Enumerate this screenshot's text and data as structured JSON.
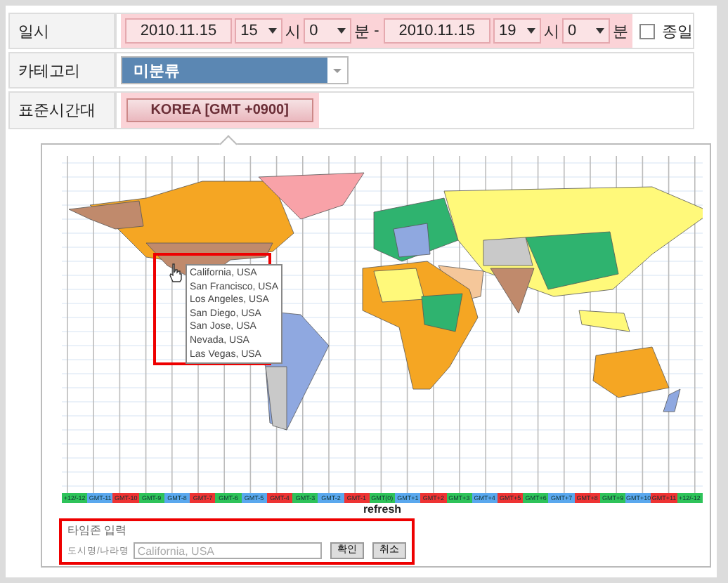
{
  "datetime": {
    "label": "일시",
    "start": {
      "date": "2010.11.15",
      "hour": "15",
      "hour_unit": "시",
      "minute": "0",
      "minute_unit": "분"
    },
    "separator": "-",
    "end": {
      "date": "2010.11.15",
      "hour": "19",
      "hour_unit": "시",
      "minute": "0",
      "minute_unit": "분"
    },
    "all_day": {
      "label": "종일",
      "checked": false
    }
  },
  "category": {
    "label": "카테고리",
    "value": "미분류"
  },
  "timezone": {
    "label": "표준시간대",
    "button": "KOREA [GMT +0900]"
  },
  "map": {
    "popup": {
      "items": [
        "California, USA",
        "San Francisco, USA",
        "Los Angeles, USA",
        "San Diego, USA",
        "San Jose, USA",
        "Nevada, USA",
        "Las Vegas, USA"
      ]
    },
    "zone_strip": [
      {
        "label": "+12/-12",
        "color": "#2ec35a"
      },
      {
        "label": "GMT-11",
        "color": "#5aa8ee"
      },
      {
        "label": "GMT-10",
        "color": "#ee3333"
      },
      {
        "label": "GMT-9",
        "color": "#2ec35a"
      },
      {
        "label": "GMT-8",
        "color": "#5aa8ee"
      },
      {
        "label": "GMT-7",
        "color": "#ee3333"
      },
      {
        "label": "GMT-6",
        "color": "#2ec35a"
      },
      {
        "label": "GMT-5",
        "color": "#5aa8ee"
      },
      {
        "label": "GMT-4",
        "color": "#ee3333"
      },
      {
        "label": "GMT-3",
        "color": "#2ec35a"
      },
      {
        "label": "GMT-2",
        "color": "#5aa8ee"
      },
      {
        "label": "GMT-1",
        "color": "#ee3333"
      },
      {
        "label": "GMT(0)",
        "color": "#2ec35a"
      },
      {
        "label": "GMT+1",
        "color": "#5aa8ee"
      },
      {
        "label": "GMT+2",
        "color": "#ee3333"
      },
      {
        "label": "GMT+3",
        "color": "#2ec35a"
      },
      {
        "label": "GMT+4",
        "color": "#5aa8ee"
      },
      {
        "label": "GMT+5",
        "color": "#ee3333"
      },
      {
        "label": "GMT+6",
        "color": "#2ec35a"
      },
      {
        "label": "GMT+7",
        "color": "#5aa8ee"
      },
      {
        "label": "GMT+8",
        "color": "#ee3333"
      },
      {
        "label": "GMT+9",
        "color": "#2ec35a"
      },
      {
        "label": "GMT+10",
        "color": "#5aa8ee"
      },
      {
        "label": "GMT+11",
        "color": "#ee3333"
      },
      {
        "label": "+12/-12",
        "color": "#2ec35a"
      }
    ],
    "refresh": "refresh"
  },
  "timezone_input": {
    "title": "타임존 입력",
    "field_label": "도시명/나라명",
    "placeholder": "California, USA",
    "buttons": [
      "확인",
      "취소"
    ]
  }
}
